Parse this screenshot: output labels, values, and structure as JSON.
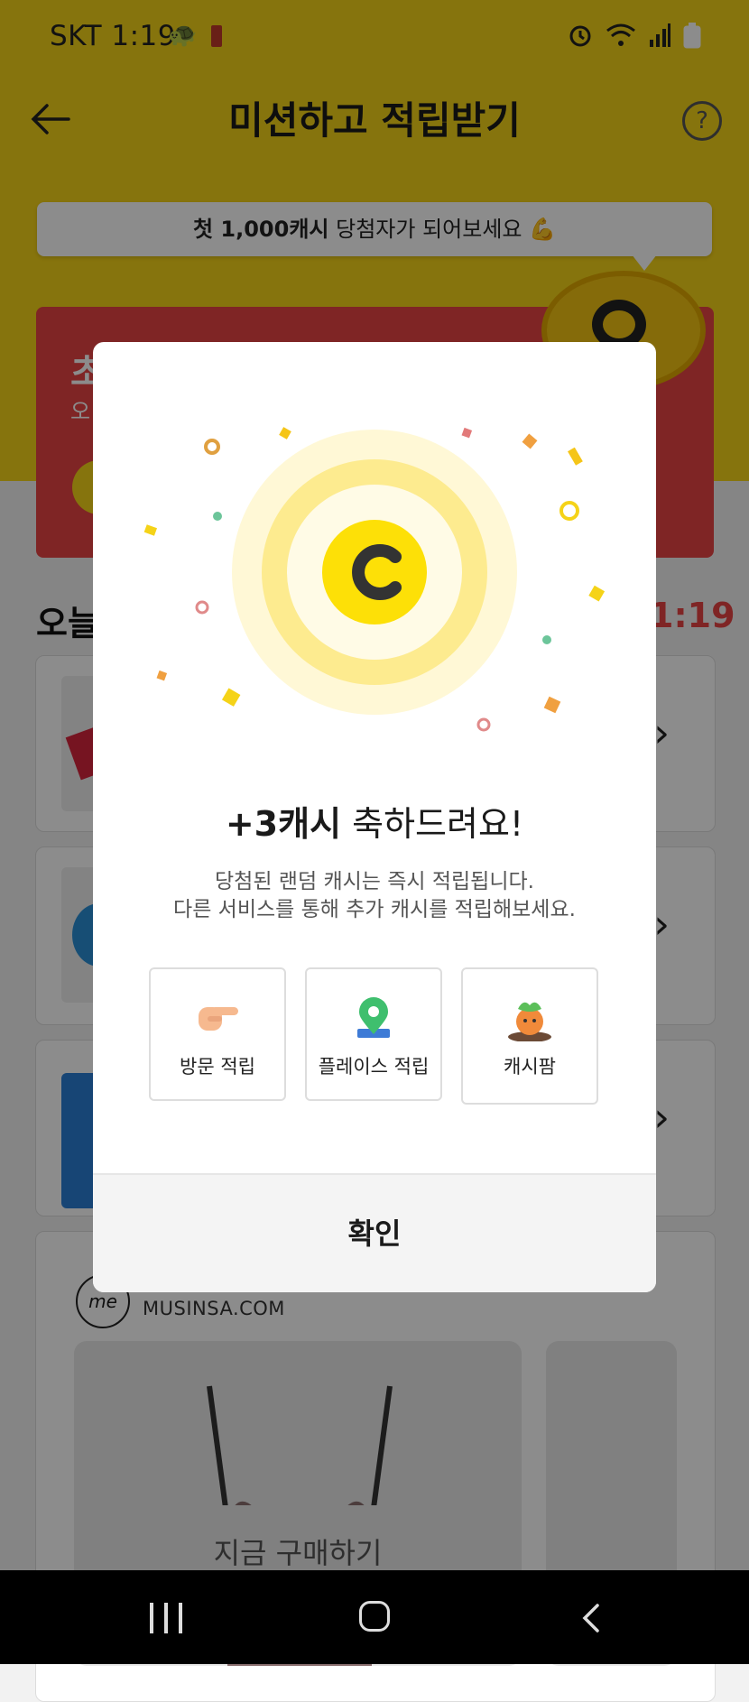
{
  "status_bar": {
    "carrier_time": "SKT 1:19"
  },
  "app_bar": {
    "title": "미션하고 적립받기",
    "help_glyph": "?"
  },
  "banner_bubble": {
    "bold_text": "첫 1,000캐시",
    "rest_text": " 당첨자가 되어보세요 💪"
  },
  "red_card": {
    "title": "초",
    "subtitle": "오"
  },
  "today": {
    "title": "오늘",
    "timer": "1:19"
  },
  "list": {
    "chevron": "›"
  },
  "musinsa": {
    "logo_text": "me",
    "url": "MUSINSA.COM",
    "buy_label": "지금 구매하기"
  },
  "modal": {
    "title_bold": "+3캐시",
    "title_rest": " 축하드려요!",
    "desc_line1": "당첨된 랜덤 캐시는 즉시 적립됩니다.",
    "desc_line2": "다른 서비스를 통해 추가 캐시를 적립해보세요.",
    "services": [
      {
        "label": "방문 적립",
        "icon": "pointing-hand-icon"
      },
      {
        "label": "플레이스 적립",
        "icon": "location-pin-icon"
      },
      {
        "label": "캐시팜",
        "icon": "carrot-character-icon"
      }
    ],
    "confirm_label": "확인"
  },
  "colors": {
    "brand_yellow": "#f5d318",
    "accent_red": "#e84444",
    "coin_yellow": "#fde007"
  }
}
